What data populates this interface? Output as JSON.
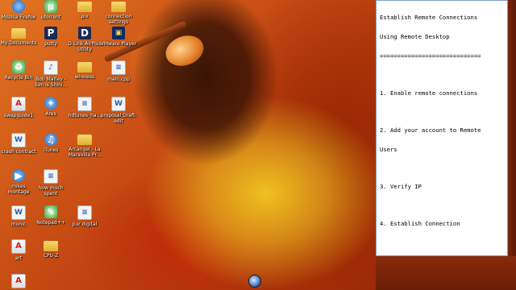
{
  "desktop": {
    "icons": [
      {
        "label": "Mozilla Firefox",
        "glyph": "",
        "icon": "firefox-icon"
      },
      {
        "label": "utorrent",
        "glyph": "µ",
        "icon": "utorrent-icon"
      },
      {
        "label": "pix",
        "glyph": "",
        "icon": "folder-icon"
      },
      {
        "label": "connection settings",
        "glyph": "",
        "icon": "folder-icon"
      },
      {
        "label": "My Documents",
        "glyph": "",
        "icon": "my-documents-icon"
      },
      {
        "label": "putty",
        "glyph": "P",
        "icon": "putty-icon"
      },
      {
        "label": "D-Link AirPlus Utility",
        "glyph": "D",
        "icon": "dlink-icon"
      },
      {
        "label": "VMware Player",
        "glyph": "▣",
        "icon": "vmware-icon"
      },
      {
        "label": "Recycle Bin",
        "glyph": "♻",
        "icon": "recycle-bin-icon"
      },
      {
        "label": "Bob Marley - Sun is Shini...",
        "glyph": "♪",
        "icon": "audio-file-icon"
      },
      {
        "label": "wireless",
        "glyph": "",
        "icon": "folder-icon"
      },
      {
        "label": "main.cpp",
        "glyph": "≡",
        "icon": "cpp-file-icon"
      },
      {
        "label": "swapguide1",
        "glyph": "A",
        "icon": "pdf-icon"
      },
      {
        "label": "Ares",
        "glyph": "✦",
        "icon": "ares-icon"
      },
      {
        "label": "hdtunes_ha...",
        "glyph": "≡",
        "icon": "text-file-icon"
      },
      {
        "label": "proposal Draft-edit",
        "glyph": "W",
        "icon": "word-doc-icon"
      },
      {
        "label": "crash contract",
        "glyph": "W",
        "icon": "word-doc-icon"
      },
      {
        "label": "iTunes",
        "glyph": "♫",
        "icon": "itunes-icon"
      },
      {
        "label": "Arcangel - La Maravilla Pr...",
        "glyph": "",
        "icon": "folder-icon"
      },
      {
        "label": "mikes montage",
        "glyph": "▶",
        "icon": "media-file-icon"
      },
      {
        "label": "how much spent",
        "glyph": "≡",
        "icon": "text-file-icon"
      },
      {
        "label": "munic",
        "glyph": "W",
        "icon": "word-doc-icon"
      },
      {
        "label": "Notepad++",
        "glyph": "✎",
        "icon": "notepad-plus-icon"
      },
      {
        "label": "pur digital",
        "glyph": "≡",
        "icon": "text-file-icon"
      },
      {
        "label": "art",
        "glyph": "A",
        "icon": "pdf-icon"
      },
      {
        "label": "CPU-Z",
        "glyph": "",
        "icon": "folder-icon"
      },
      {
        "label": "",
        "glyph": "A",
        "icon": "pdf-icon"
      }
    ]
  },
  "notepad": {
    "lines": [
      "Establish Remote Connections",
      "Using Remote Desktop",
      "=============================",
      "",
      "1. Enable remote connections",
      "",
      "2. Add your account to Remote",
      "Users",
      "",
      "3. Verify IP",
      "",
      "4. Establish Connection"
    ]
  }
}
